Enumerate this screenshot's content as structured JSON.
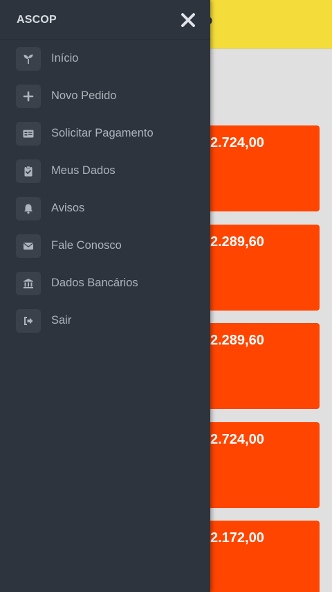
{
  "app": {
    "header_mark": "P",
    "cards": [
      {
        "value": "2.724,00"
      },
      {
        "value": "2.289,60"
      },
      {
        "value": "2.289,60"
      },
      {
        "value": "2.724,00"
      },
      {
        "value": "2.172,00"
      }
    ],
    "colors": {
      "header": "#f4dd3b",
      "card": "#ff4500",
      "background": "#e0e0e0"
    }
  },
  "drawer": {
    "title": "ASCOP",
    "close_icon": "close-icon",
    "background": "#2e343d",
    "items": [
      {
        "label": "Início",
        "icon": "sprout-icon"
      },
      {
        "label": "Novo Pedido",
        "icon": "plus-icon"
      },
      {
        "label": "Solicitar Pagamento",
        "icon": "id-card-icon"
      },
      {
        "label": "Meus Dados",
        "icon": "clipboard-check-icon"
      },
      {
        "label": "Avisos",
        "icon": "bell-icon"
      },
      {
        "label": "Fale Conosco",
        "icon": "envelope-icon"
      },
      {
        "label": "Dados Bancários",
        "icon": "bank-icon"
      },
      {
        "label": "Sair",
        "icon": "sign-out-icon"
      }
    ]
  }
}
